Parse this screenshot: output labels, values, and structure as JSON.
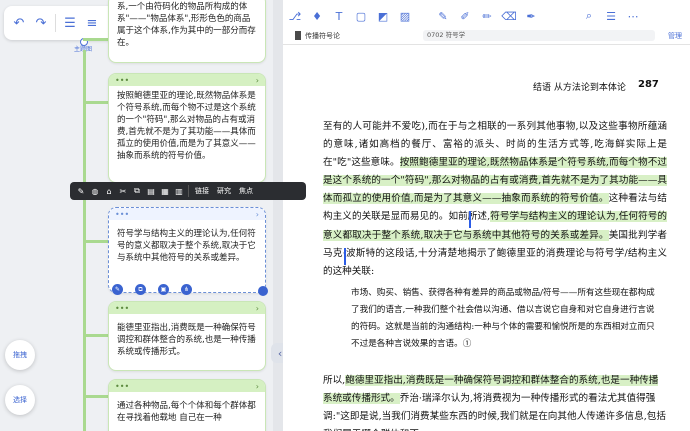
{
  "left_toolbar": {
    "icons": [
      "undo-icon",
      "redo-icon",
      "outline-icon",
      "list-icon",
      "add-item-icon",
      "indent-icon",
      "search-icon"
    ]
  },
  "hub_label": "主题图",
  "cards": [
    {
      "text": "系,一个由符码化的物品所构成的体系\"——\"物品体系\",形形色色的商品属于这个体系,作为其中的一部分而存在。"
    },
    {
      "text": "按照鲍德里亚的理论,既然物品体系是个符号系统,而每个物不过是这个系统的一个\"符码\",那么对物品的占有或消费,首先就不是为了其功能——具体而孤立的使用价值,而是为了其意义——抽象而系统的符号价值。"
    },
    {
      "text": "符号学与结构主义的理论认为,任何符号的意义都取决于整个系统,取决于它与系统中其他符号的关系或差异。"
    },
    {
      "text": "能德里亚指出,消费既是一种确保符号调控和群体整合的系统,也是一种传播系统或传播形式。"
    },
    {
      "text": "通过各种物品,每个个体和每个群体都在寻找着他载地 自己在一种"
    }
  ],
  "context_menu": {
    "link_label": "链接",
    "research_label": "研究",
    "focus_label": "焦点"
  },
  "fab": {
    "drag_label": "拖拽",
    "select_label": "选择"
  },
  "reader": {
    "book_title": "传播符号论",
    "chapter": "0702 符号学",
    "manage_label": "管理",
    "running_head": "结语  从方法论到本体论",
    "page_number": "287",
    "para1_a": "至有的人可能并不爱吃),而在于与之相联的一系列其他事物,以及这些事物所蕴涵的意味,诸如高档的餐厅、富裕的派头、时尚的生活方式等,吃海鲜实际上是在\"吃\"这些意味。",
    "para1_hl1": "按照鲍德里亚的理论,既然物品体系是个符号系统,而每个物不过是这个系统的一个\"符码\",那么对物品的占有或消费,首先就不是为了其功能——具体而孤立的使用价值,而是为了其意义——抽象而系统的符号价值。",
    "para1_b": "这种看法与结构主义的关联是显而易见的。如前所述,",
    "para1_hl2": "符号学与结构主义的理论认为,任何符号的意义都取决于整个系统,取决于它与系统中其他符号的关系或差异。",
    "para1_c": "美国批判学者马克·波斯特的这段话,十分清楚地揭示了鲍德里亚的消费理论与符号学/结构主义的这种关联:",
    "quote": "市场、购买、销售、获得各种有差异的商品或物品/符号——所有这些现在都构成了我们的语言,一种我们整个社会借以沟通、借以言说它自身和对它自身进行言说的符码。这就是当前的沟通结构:一种与个体的需要和愉悦所是的东西相对立而只不过是各种言说效果的言语。①",
    "para2_a": "所以,",
    "para2_hl": "鲍德里亚指出,消费既是一种确保符号调控和群体整合的系统,也是一种传播系统或传播形式。",
    "para2_b": "乔治·瑞泽尔认为,将消费视为一种传播形式的看法尤其值得强调:\"这即是说,当我们消费某些东西的时候,我们就是在向其他人传递许多信息,包括我们属于哪个群体和不"
  },
  "reader_toolbar": {
    "icons": [
      "mind-map-icon",
      "highlight-icon",
      "text-icon",
      "rect-select-icon",
      "chart-icon",
      "image-icon",
      "pen-icon",
      "marker-icon",
      "marker-dark-icon",
      "eraser-icon",
      "color-marker-icon",
      "search-icon",
      "list-icon",
      "more-icon"
    ]
  }
}
